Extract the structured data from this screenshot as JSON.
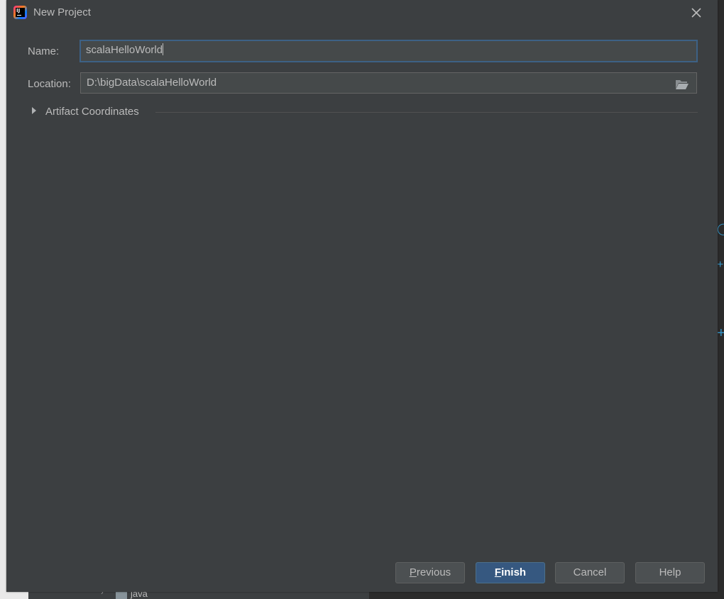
{
  "window": {
    "title": "New Project",
    "icon": "intellij-idea-icon",
    "icon_text": "IJ"
  },
  "form": {
    "name_label": "Name:",
    "name_value": "scalaHelloWorld",
    "location_label": "Location:",
    "location_value": "D:\\bigData\\scalaHelloWorld",
    "browse_icon": "folder-open-icon"
  },
  "artifact": {
    "label": "Artifact Coordinates",
    "expanded": false
  },
  "buttons": {
    "previous_mnemonic": "P",
    "previous_rest": "revious",
    "finish_mnemonic": "F",
    "finish_rest": "inish",
    "cancel": "Cancel",
    "help": "Help"
  },
  "background": {
    "tree_item_label": "java"
  },
  "colors": {
    "dialog_bg": "#3c3f41",
    "field_bg": "#45494a",
    "focus_border": "#3d6185",
    "primary_button": "#365880",
    "text": "#bbbbbb"
  }
}
